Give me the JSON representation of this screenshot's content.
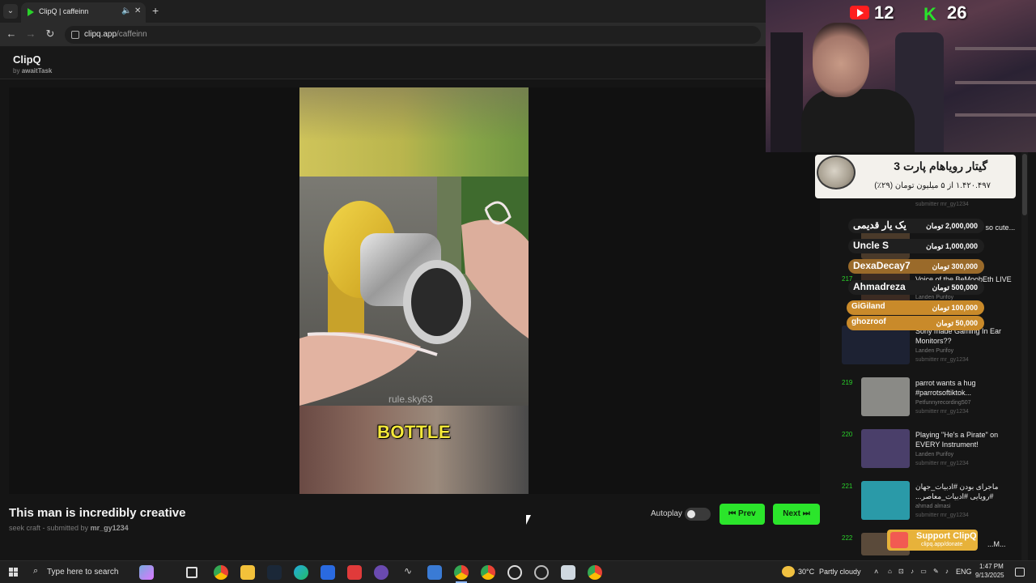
{
  "browser": {
    "tab_title": "ClipQ | caffeinn",
    "url_domain": "clipq.app",
    "url_path": "/caffeinn"
  },
  "app": {
    "brand": "ClipQ",
    "byline_prefix": "by",
    "byline_author": "awaitTask"
  },
  "video": {
    "caption": "BOTTLE",
    "watermark": "rule.sky63",
    "title": "This man is incredibly creative",
    "channel": "seek craft",
    "submitted_prefix": "- submitted by",
    "submitter": "mr_gy1234"
  },
  "controls": {
    "autoplay_label": "Autoplay",
    "autoplay_on": false,
    "prev_label": "Prev",
    "next_label": "Next"
  },
  "queue": [
    {
      "num": "",
      "title": "",
      "channel": "",
      "submitter": "submitter mr_gy1234"
    },
    {
      "num": "",
      "title": "...n stop petting them so cute...",
      "channel": "",
      "submitter": ""
    },
    {
      "num": "217",
      "title": "Voice of the BeMoobEth LIVE ...s",
      "channel": "Landen Purifoy",
      "submitter": ""
    },
    {
      "num": "218",
      "title": "Sony made Gaming In Ear Monitors??",
      "channel": "Landen Purifoy",
      "submitter": "submitter mr_gy1234"
    },
    {
      "num": "219",
      "title": "parrot wants a hug #parrotsoftiktok...",
      "channel": "Petfunnyrecording507",
      "submitter": "submitter mr_gy1234"
    },
    {
      "num": "220",
      "title": "Playing \"He's a Pirate\" on EVERY Instrument!",
      "channel": "Landen Purifoy",
      "submitter": "submitter mr_gy1234"
    },
    {
      "num": "221",
      "title": "ماجرای بودن #ادبیات_جهان #رویایی #ادبیات_معاصر...",
      "channel": "ahmad almasi",
      "submitter": "submitter mr_gy1234"
    },
    {
      "num": "222",
      "title": "...M...",
      "channel": "",
      "submitter": ""
    }
  ],
  "donation": {
    "goal_title": "گیتار رویاهام پارت 3",
    "goal_progress": "۱.۴۲۰.۴۹۷ از ۵ میلیون تومان (۲۹٪)",
    "donors": [
      {
        "name": "یک یار قدیمی",
        "amount": "2,000,000 تومان",
        "color": "#1f1f1f"
      },
      {
        "name": "Uncle S",
        "amount": "1,000,000 تومان",
        "color": "#1f1f1f"
      },
      {
        "name": "DexaDecay7",
        "amount": "300,000 تومان",
        "color": "#9a6a2a"
      },
      {
        "name": "Ahmadreza",
        "amount": "500,000 تومان",
        "color": "#1f1f1f"
      },
      {
        "name": "GiGiland",
        "amount": "100,000 تومان",
        "color": "#c98a2a"
      },
      {
        "name": "ghozroof",
        "amount": "50,000 تومان",
        "color": "#c98a2a"
      }
    ]
  },
  "support": {
    "label": "Support ClipQ",
    "url": "clipq.app/donate"
  },
  "webcam": {
    "youtube_count": "12",
    "kick_count": "26"
  },
  "taskbar": {
    "search_placeholder": "Type here to search",
    "weather_temp": "30°C",
    "weather_desc": "Partly cloudy",
    "language": "ENG",
    "time": "1:47 PM",
    "date": "9/13/2025"
  },
  "colors": {
    "accent_green": "#2be52b",
    "gold": "#e7b23a",
    "youtube_red": "#ff1e1e",
    "kick_green": "#29e12c"
  }
}
